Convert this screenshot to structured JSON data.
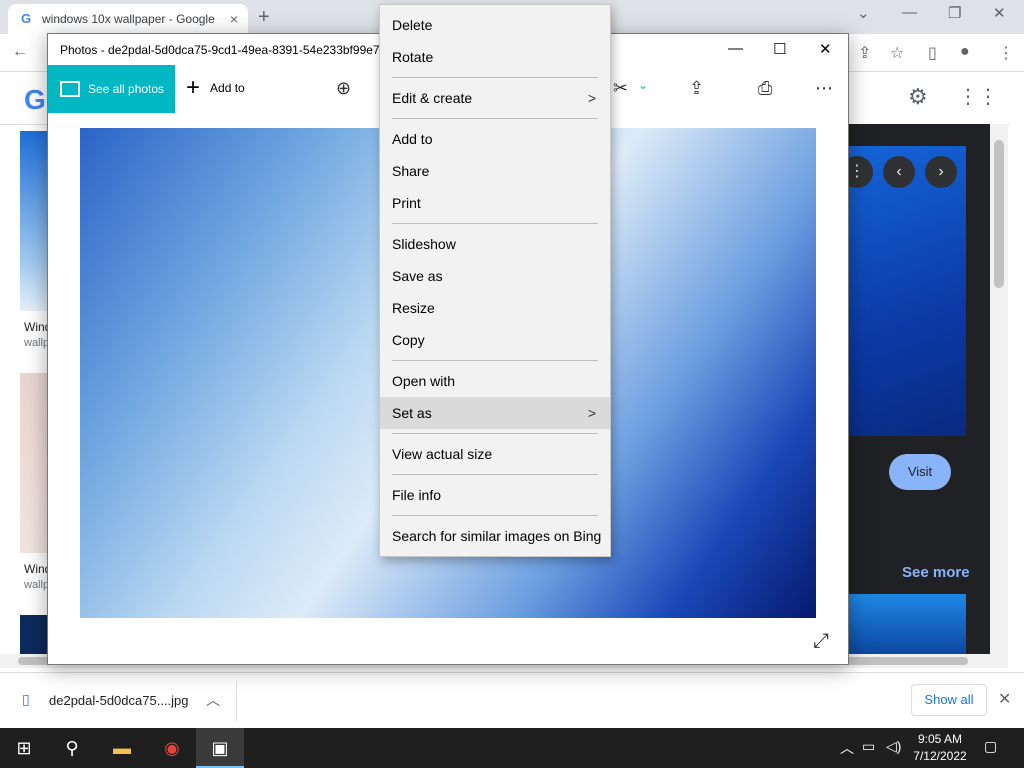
{
  "browser": {
    "tab_title": "windows 10x wallpaper - Google",
    "tab_close": "×",
    "new_tab": "+",
    "window_controls": [
      "⌄",
      "—",
      "❐",
      "✕"
    ],
    "toolbar_icons": [
      "←",
      "⇪",
      "☆",
      "▯",
      "●",
      "⋮"
    ],
    "google": {
      "logo": "G",
      "thumbnails": [
        {
          "label": "Wind",
          "source": "wallp"
        },
        {
          "label": "Wind",
          "source": "wallp"
        }
      ],
      "side_panel": {
        "visit": "Visit",
        "see_more": "See more"
      }
    },
    "download_bar": {
      "file": "de2pdal-5d0dca75....jpg",
      "show_all": "Show all",
      "close": "✕"
    }
  },
  "photos_window": {
    "title": "Photos - de2pdal-5d0dca75-9cd1-49ea-8391-54e233bf99e7",
    "see_all_photos": "See all photos",
    "add_to": "Add to",
    "controls": [
      "—",
      "☐",
      "✕"
    ]
  },
  "context_menu": {
    "items": [
      {
        "label": "Delete",
        "submenu": false,
        "highlighted": false
      },
      {
        "label": "Rotate",
        "submenu": false,
        "highlighted": false
      },
      {
        "label": "Edit & create",
        "submenu": true,
        "highlighted": false
      },
      {
        "label": "Add to",
        "submenu": false,
        "highlighted": false
      },
      {
        "label": "Share",
        "submenu": false,
        "highlighted": false
      },
      {
        "label": "Print",
        "submenu": false,
        "highlighted": false
      },
      {
        "label": "Slideshow",
        "submenu": false,
        "highlighted": false
      },
      {
        "label": "Save as",
        "submenu": false,
        "highlighted": false
      },
      {
        "label": "Resize",
        "submenu": false,
        "highlighted": false
      },
      {
        "label": "Copy",
        "submenu": false,
        "highlighted": false
      },
      {
        "label": "Open with",
        "submenu": false,
        "highlighted": false
      },
      {
        "label": "Set as",
        "submenu": true,
        "highlighted": true
      },
      {
        "label": "View actual size",
        "submenu": false,
        "highlighted": false
      },
      {
        "label": "File info",
        "submenu": false,
        "highlighted": false
      },
      {
        "label": "Search for similar images on Bing",
        "submenu": false,
        "highlighted": false
      }
    ],
    "submenu_arrow": ">"
  },
  "taskbar": {
    "time": "9:05 AM",
    "date": "7/12/2022"
  }
}
